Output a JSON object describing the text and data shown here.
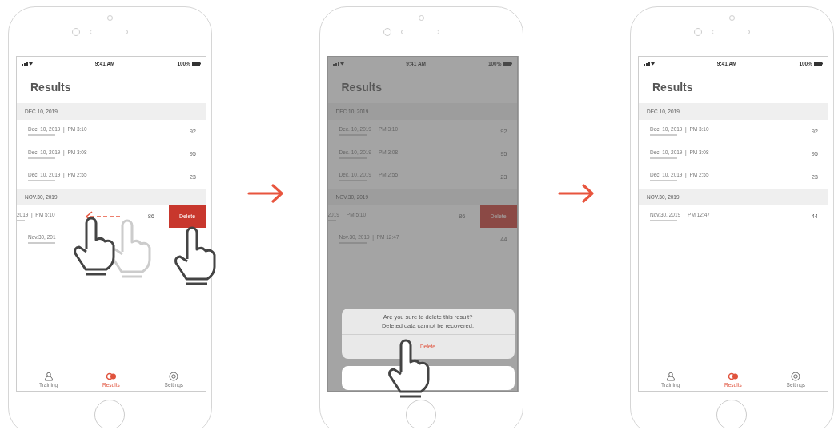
{
  "phones": [
    {
      "dimmed": false,
      "kind": "swipe",
      "status": {
        "time": "9:41 AM",
        "battery": "100%"
      },
      "title": "Results",
      "sections": [
        {
          "header": "DEC 10, 2019",
          "rows": [
            {
              "datetime": "Dec. 10, 2019  |  PM 3:10",
              "score": "92",
              "swiped": false
            },
            {
              "datetime": "Dec. 10, 2019  |  PM 3:08",
              "score": "95",
              "swiped": false
            },
            {
              "datetime": "Dec. 10, 2019  |  PM 2:55",
              "score": "23",
              "swiped": false
            }
          ]
        },
        {
          "header": "NOV.30, 2019",
          "rows": [
            {
              "datetime": "2019  |  PM 5:10",
              "score": "86",
              "swiped": true,
              "action": "Delete"
            },
            {
              "datetime": "Nov.30, 201",
              "swiped": false
            }
          ]
        }
      ],
      "tabs": [
        {
          "label": "Training",
          "selected": false
        },
        {
          "label": "Results",
          "selected": true
        },
        {
          "label": "Settings",
          "selected": false
        }
      ]
    },
    {
      "dimmed": true,
      "kind": "confirm",
      "status": {
        "time": "9:41 AM",
        "battery": "100%"
      },
      "title": "Results",
      "sections": [
        {
          "header": "DEC 10, 2019",
          "rows": [
            {
              "datetime": "Dec. 10, 2019  |  PM 3:10",
              "score": "92",
              "swiped": false
            },
            {
              "datetime": "Dec. 10, 2019  |  PM 3:08",
              "score": "95",
              "swiped": false
            },
            {
              "datetime": "Dec. 10, 2019  |  PM 2:55",
              "score": "23",
              "swiped": false
            }
          ]
        },
        {
          "header": "NOV.30, 2019",
          "rows": [
            {
              "datetime": "2019  |  PM 5:10",
              "score": "86",
              "swiped": true,
              "action": "Delete"
            },
            {
              "datetime": "Nov.30, 2019  |  PM 12:47",
              "score": "44",
              "swiped": false
            }
          ]
        }
      ],
      "dialog": {
        "message": "Are you sure to delete this result?",
        "detail": "Deleted data cannot be recovered.",
        "confirm": "Delete"
      }
    },
    {
      "dimmed": false,
      "kind": "result",
      "status": {
        "time": "9:41 AM",
        "battery": "100%"
      },
      "title": "Results",
      "sections": [
        {
          "header": "DEC 10, 2019",
          "rows": [
            {
              "datetime": "Dec. 10, 2019  |  PM 3:10",
              "score": "92",
              "swiped": false
            },
            {
              "datetime": "Dec. 10, 2019  |  PM 3:08",
              "score": "95",
              "swiped": false
            },
            {
              "datetime": "Dec. 10, 2019  |  PM 2:55",
              "score": "23",
              "swiped": false
            }
          ]
        },
        {
          "header": "NOV.30, 2019",
          "rows": [
            {
              "datetime": "Nov.30, 2019  |  PM 12:47",
              "score": "44",
              "swiped": false
            }
          ]
        }
      ],
      "tabs": [
        {
          "label": "Training",
          "selected": false
        },
        {
          "label": "Results",
          "selected": true
        },
        {
          "label": "Settings",
          "selected": false
        }
      ]
    }
  ]
}
